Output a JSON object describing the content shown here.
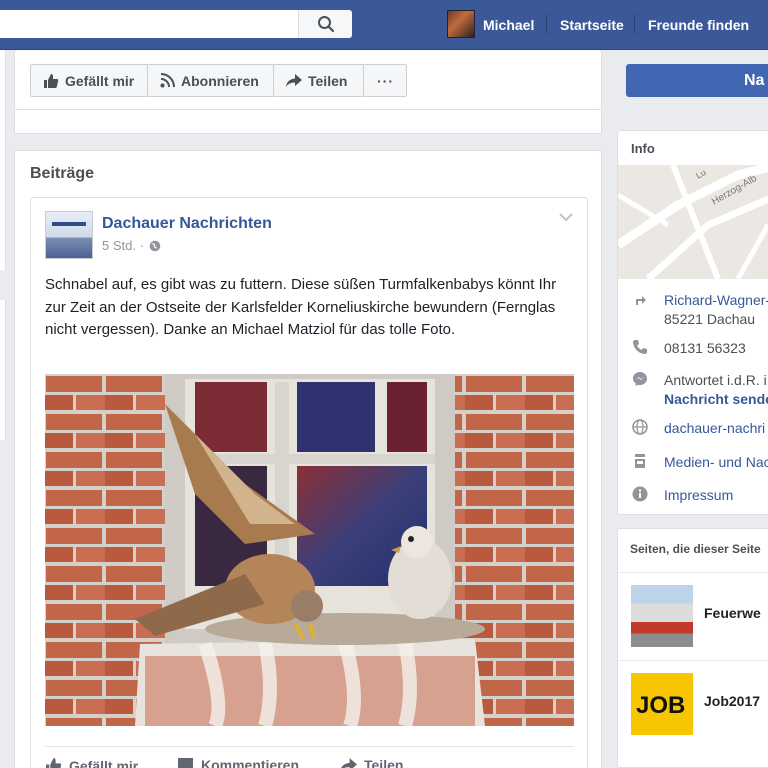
{
  "header": {
    "search_placeholder": "",
    "user_name": "Michael",
    "nav_home": "Startseite",
    "nav_find_friends": "Freunde finden"
  },
  "page_actions": {
    "like": "Gefällt mir",
    "follow": "Abonnieren",
    "share": "Teilen",
    "more": "···",
    "message_button_partial": "Na"
  },
  "posts_section": {
    "title": "Beiträge"
  },
  "post": {
    "author": "Dachauer Nachrichten",
    "time": "5 Std. ·",
    "text": "Schnabel auf, es gibt was zu futtern. Diese süßen Turmfalkenbabys könnt Ihr zur Zeit an der Ostseite der Karlsfelder Korneliuskirche bewundern (Fernglas nicht vergessen). Danke an Michael Matziol für das tolle Foto.",
    "photo_description": "Kestrel feeding chicks in a brick window niche",
    "actions": {
      "like": "Gefällt mir",
      "comment": "Kommentieren",
      "share": "Teilen"
    }
  },
  "info": {
    "title": "Info",
    "map_street_1": "Lu",
    "map_street_2": "Herzog-Alb",
    "address_line1": "Richard-Wagner-",
    "address_line2": "85221 Dachau",
    "phone": "08131 56323",
    "response_line1": "Antwortet i.d.R. i",
    "response_line2": "Nachricht sende",
    "website": "dachauer-nachri",
    "category": "Medien- und Nac",
    "impressum": "Impressum"
  },
  "liked_pages": {
    "title": "Seiten, die dieser Seite",
    "items": [
      {
        "name": "Feuerwe"
      },
      {
        "name": "Job2017"
      }
    ]
  },
  "colors": {
    "brand_blue": "#3b5998",
    "link_blue": "#365899",
    "cta_blue": "#4267b2",
    "background": "#e9ebee"
  }
}
